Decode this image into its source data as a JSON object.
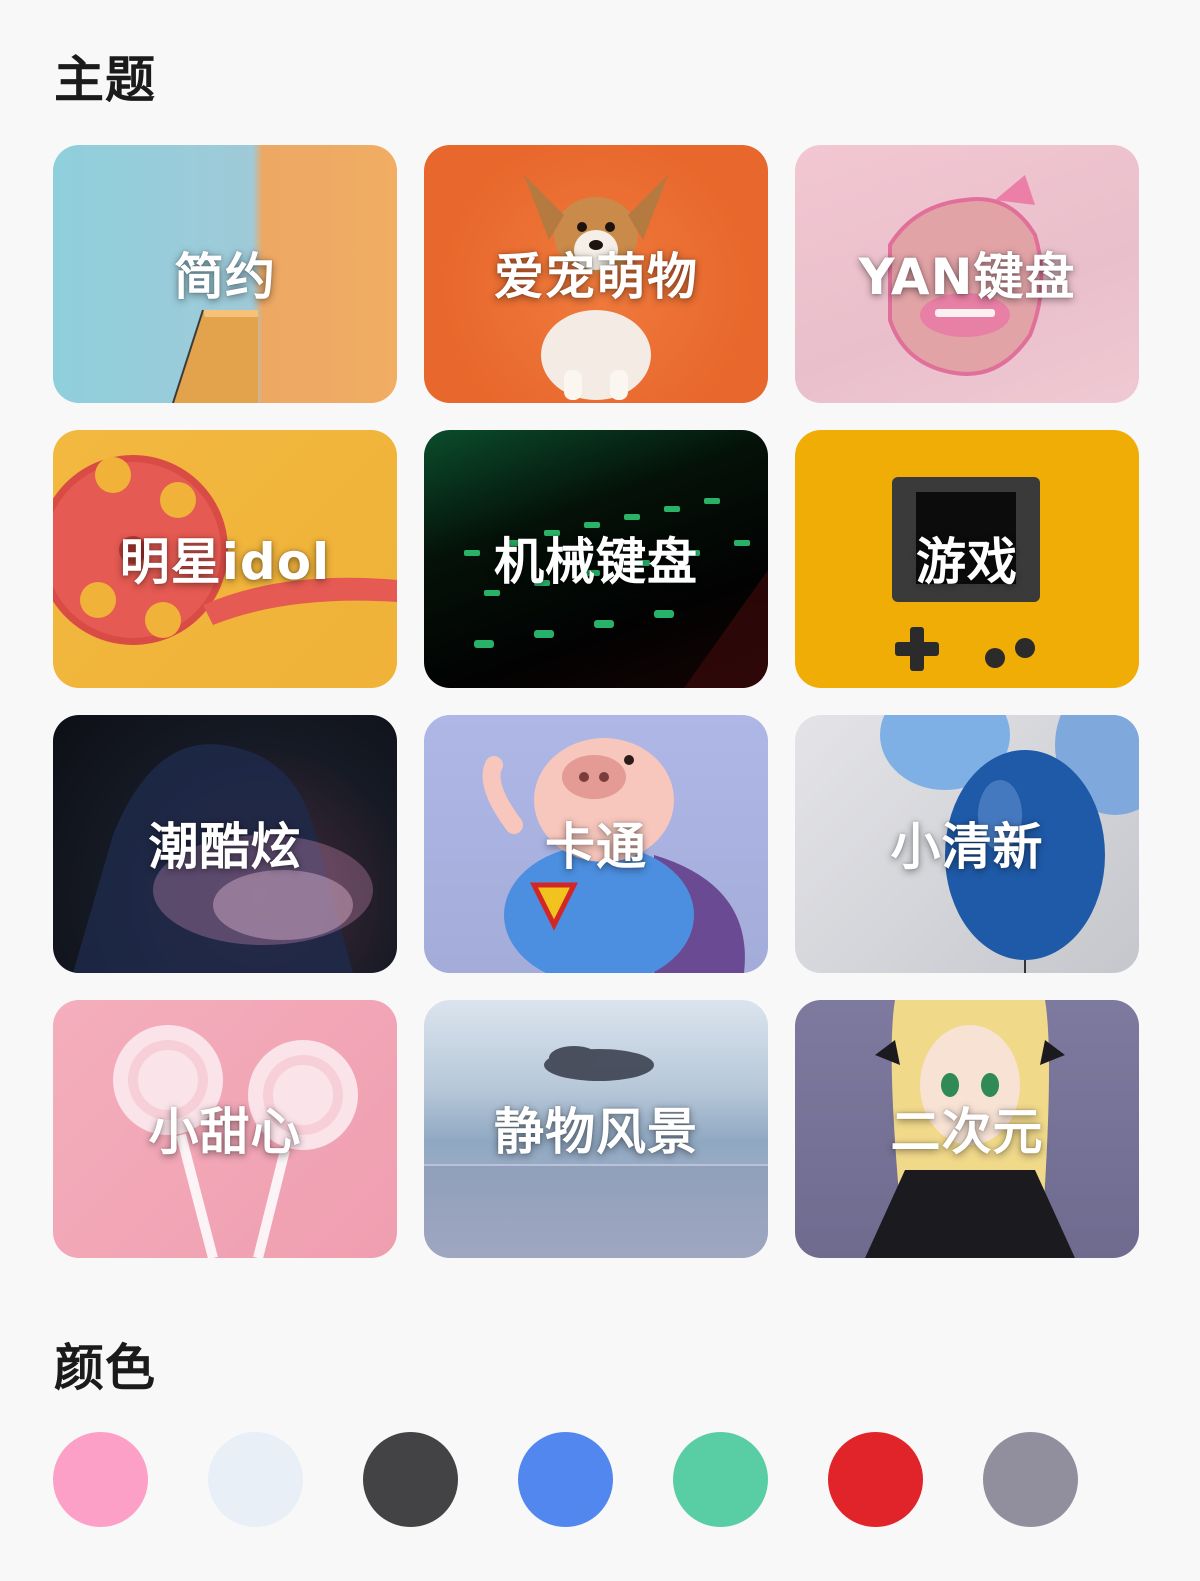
{
  "sections": {
    "themes_title": "主题",
    "colors_title": "颜色"
  },
  "themes": [
    {
      "label": "简约"
    },
    {
      "label": "爱宠萌物"
    },
    {
      "label": "YAN键盘"
    },
    {
      "label": "明星idol"
    },
    {
      "label": "机械键盘"
    },
    {
      "label": "游戏"
    },
    {
      "label": "潮酷炫"
    },
    {
      "label": "卡通"
    },
    {
      "label": "小清新"
    },
    {
      "label": "小甜心"
    },
    {
      "label": "静物风景"
    },
    {
      "label": "二次元"
    }
  ],
  "color_swatches": [
    "#fda0c8",
    "#e8eff7",
    "#434345",
    "#5287f0",
    "#59cea5",
    "#e02429",
    "#918f9e"
  ]
}
